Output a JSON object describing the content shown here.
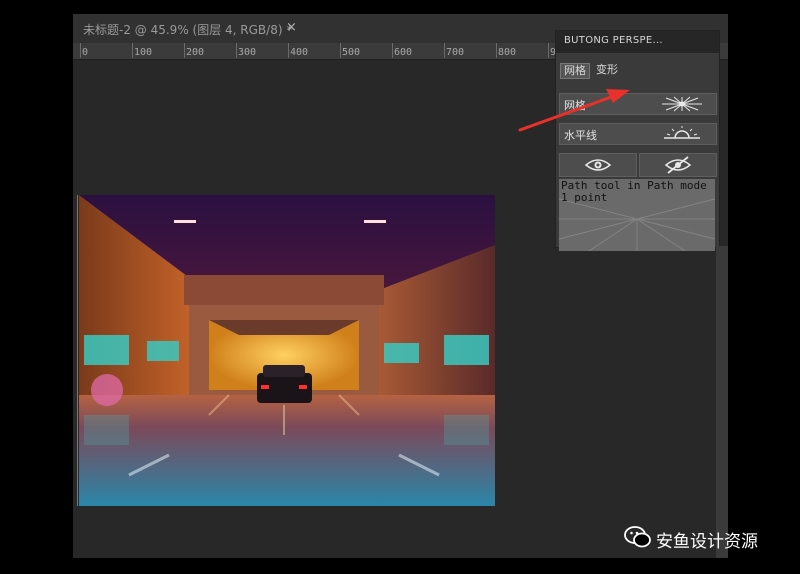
{
  "document": {
    "tab_title": "未标题-2 @ 45.9% (图层 4, RGB/8) *",
    "close_symbol": "×"
  },
  "ruler": {
    "ticks": [
      "0",
      "100",
      "200",
      "300",
      "400",
      "500",
      "600",
      "700",
      "800",
      "9"
    ]
  },
  "panel": {
    "title": "BUTONG PERSPE...",
    "tabs": [
      "网格",
      "变形"
    ],
    "buttons": {
      "grid_label": "网格",
      "horizon_label": "水平线"
    },
    "icons": [
      "starburst-icon",
      "sunrise-icon",
      "eye-gear-icon",
      "eye-slash-icon"
    ],
    "preview_text": "Path tool in Path mode\n1 point"
  },
  "colors": {
    "annotation_arrow": "#e8312b",
    "panel_bg": "#3a3a3a",
    "app_bg": "#282828"
  },
  "watermark": {
    "text": "安鱼设计资源",
    "icon": "wechat-icon"
  }
}
